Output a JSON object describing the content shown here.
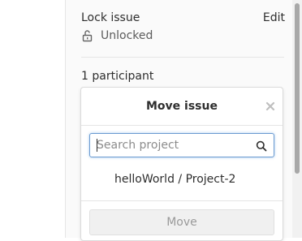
{
  "lock": {
    "title": "Lock issue",
    "edit_label": "Edit",
    "status": "Unlocked"
  },
  "participants": {
    "text": "1 participant"
  },
  "move_dropdown": {
    "title": "Move issue",
    "search_placeholder": "Search project",
    "search_value": "",
    "projects": [
      {
        "label": "helloWorld / Project-2"
      }
    ],
    "move_button_label": "Move"
  },
  "icons": {
    "lock": "unlocked-padlock-icon",
    "close": "close-icon",
    "search": "search-icon"
  }
}
